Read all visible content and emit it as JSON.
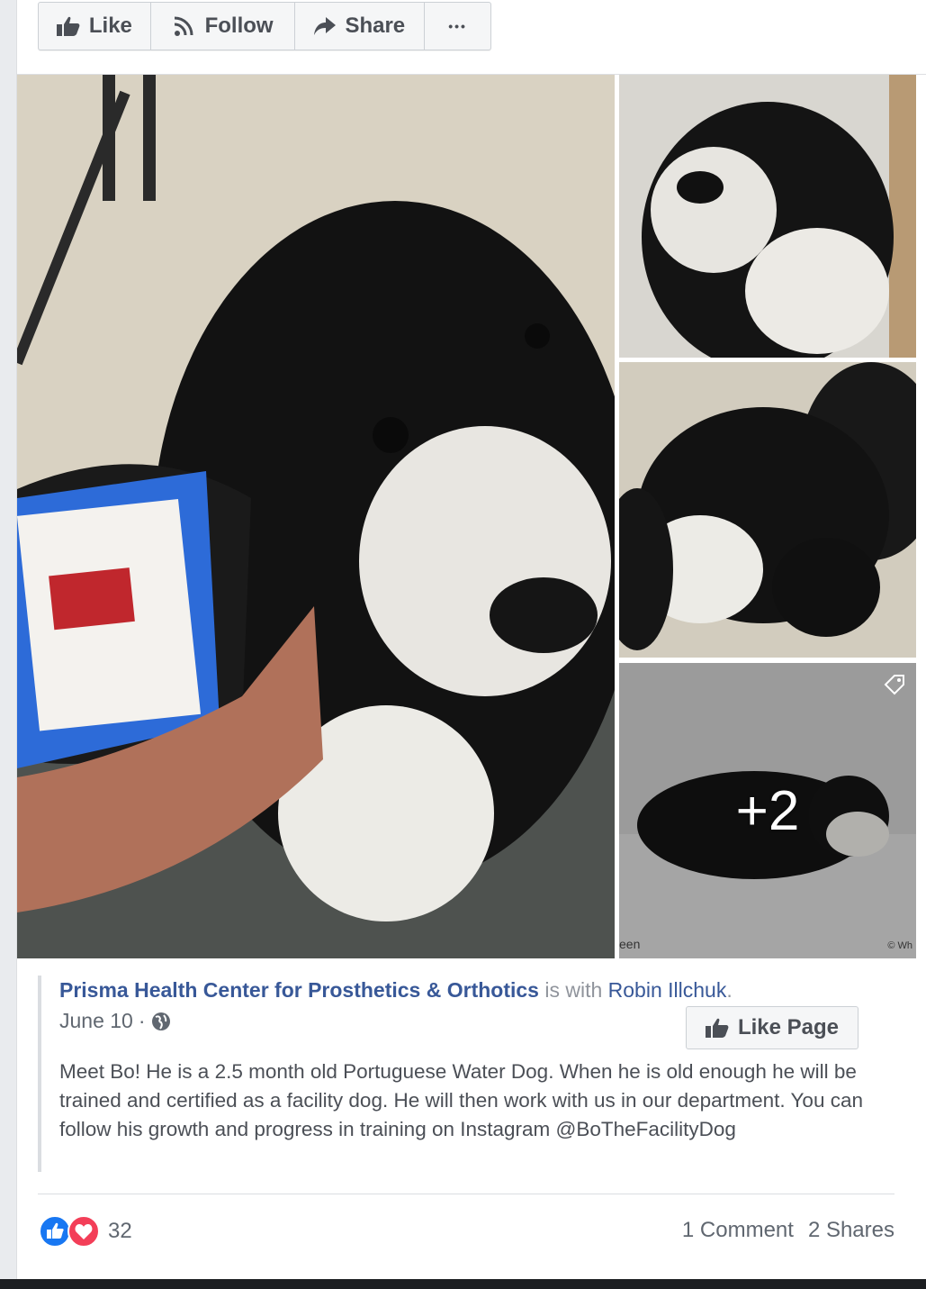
{
  "actions": {
    "like": "Like",
    "follow": "Follow",
    "share": "Share",
    "more": "•••"
  },
  "photos": {
    "more_count": "+2",
    "watermark_left": "een",
    "watermark_right": "© Wh"
  },
  "post": {
    "page_name": "Prisma Health Center for Prosthetics & Orthotics",
    "with_text": " is with ",
    "tagged_person": "Robin Illchuk",
    "period": ".",
    "date": "June 10",
    "date_sep": " ·",
    "like_page_label": "Like Page",
    "body": "Meet Bo! He is a 2.5 month old Portuguese Water Dog. When he is old enough he will be trained and certified as a facility dog. He will then work with us in our department. You can follow his growth and progress in training on Instagram @BoTheFacilityDog"
  },
  "footer": {
    "reaction_count": "32",
    "comments": "1 Comment",
    "shares": "2 Shares"
  },
  "colors": {
    "link": "#385898",
    "like_blue": "#1877f2",
    "love_red": "#f33e58"
  },
  "icons": [
    "thumbs-up-icon",
    "follow-rss-icon",
    "share-arrow-icon",
    "more-icon",
    "globe-icon",
    "tag-icon",
    "like-reaction-icon",
    "love-reaction-icon"
  ]
}
